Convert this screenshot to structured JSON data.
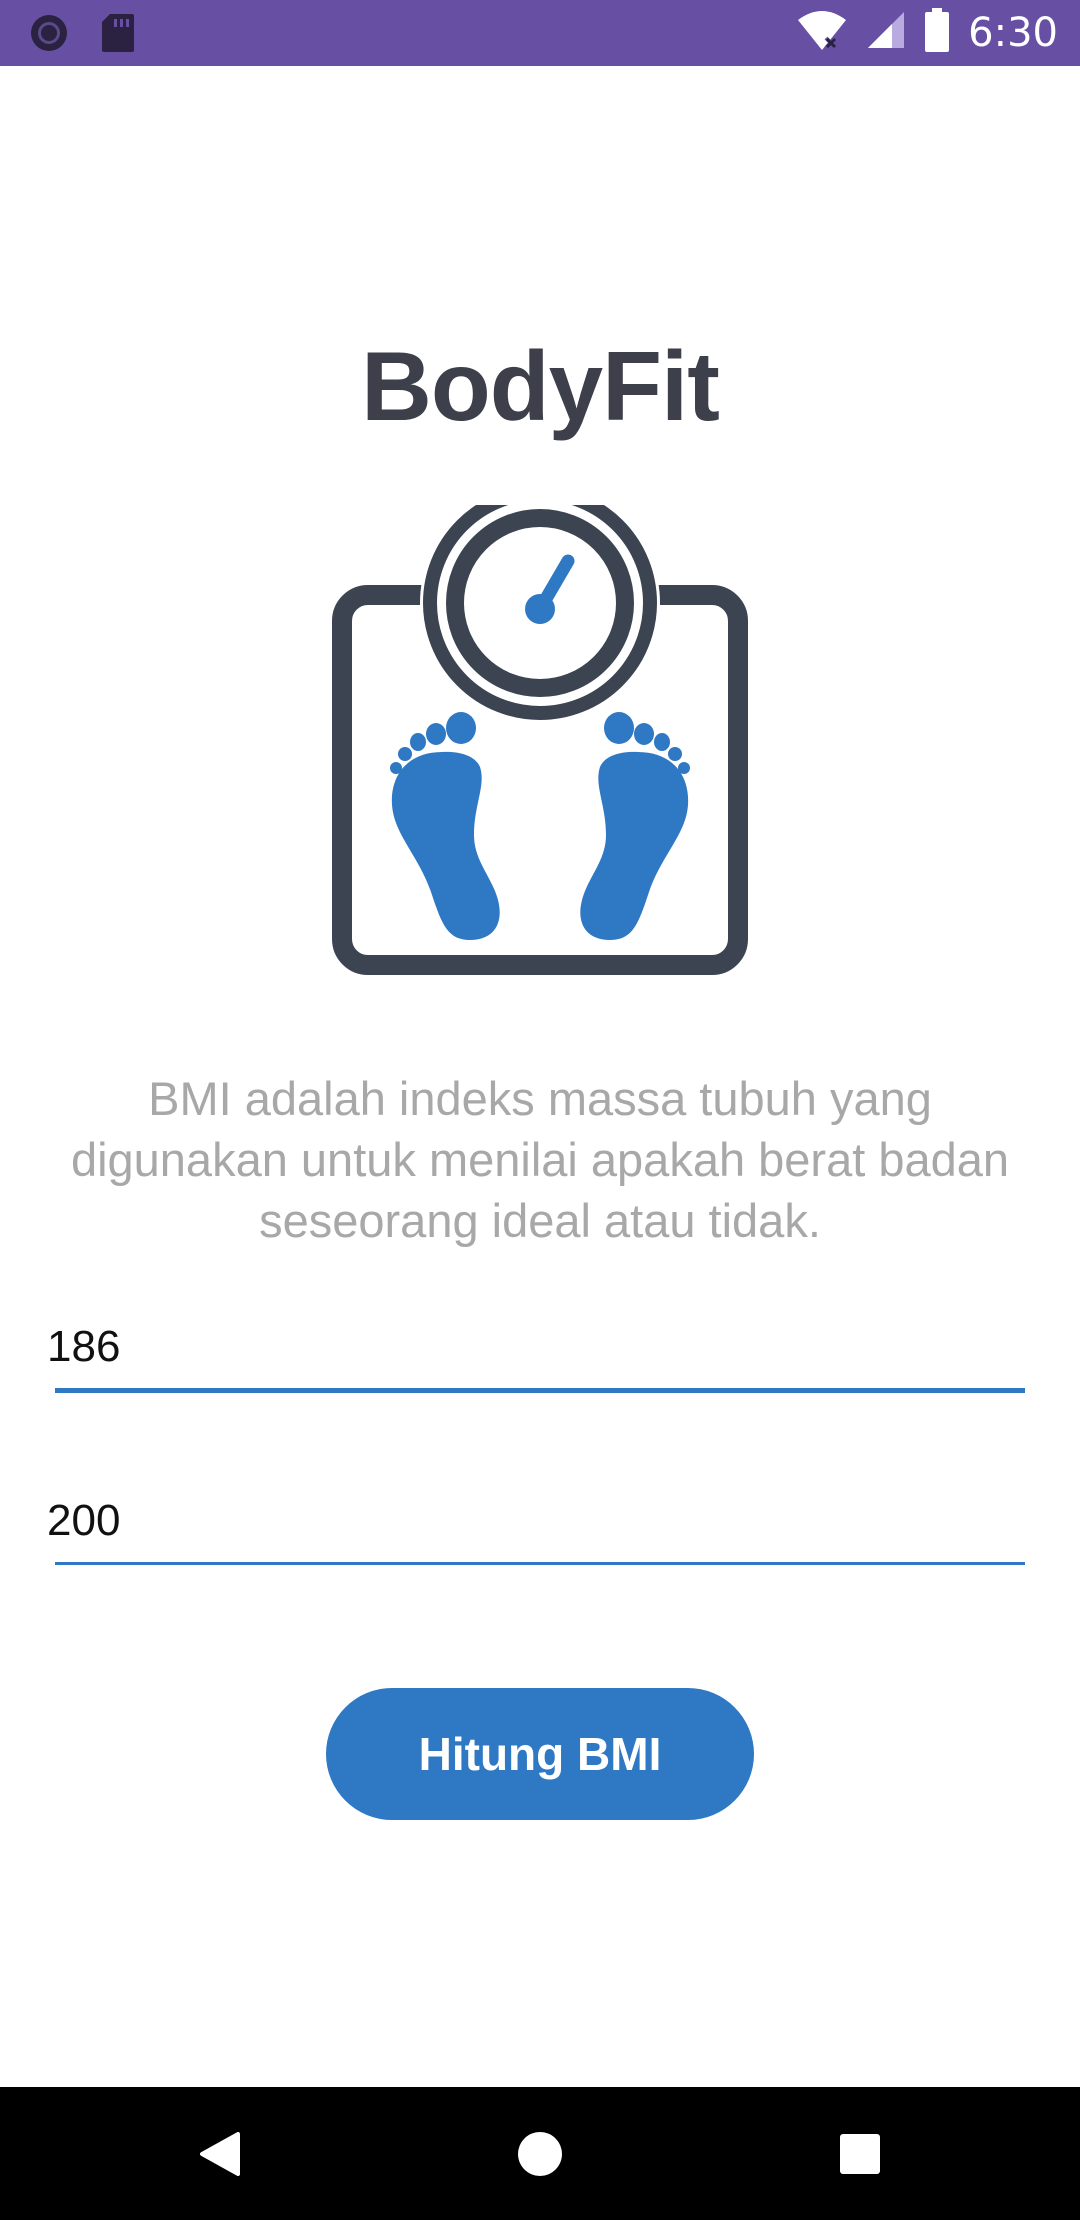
{
  "status_bar": {
    "time": "6:30",
    "icons": [
      "record-icon",
      "sd-card-icon",
      "wifi-icon",
      "signal-icon",
      "battery-icon"
    ],
    "background": "#6750a4"
  },
  "app": {
    "title": "BodyFit",
    "illustration": "bathroom-scale-with-footprints",
    "description": "BMI adalah indeks massa tubuh yang digunakan untuk menilai apakah berat badan seseorang ideal atau tidak.",
    "height_value": "186",
    "weight_value": "200",
    "button_label": "Hitung BMI"
  },
  "colors": {
    "accent": "#2f78c4",
    "title": "#3d3f4a",
    "description": "#a8a8a8",
    "scale_outline": "#3b4450"
  },
  "nav_bar": {
    "icons": [
      "back-icon",
      "home-icon",
      "recents-icon"
    ]
  }
}
